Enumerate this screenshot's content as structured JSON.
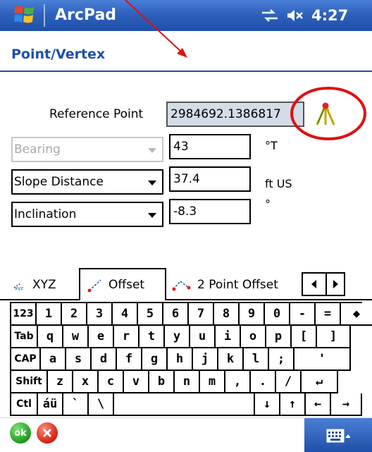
{
  "titlebar": {
    "app_title": "ArcPad",
    "time": "4:27",
    "icons": [
      "windows-start-icon",
      "connectivity-icon",
      "speaker-muted-icon"
    ]
  },
  "page": {
    "title": "Point/Vertex"
  },
  "form": {
    "reference_label": "Reference Point",
    "reference_value": "2984692.1386817",
    "rows": [
      {
        "field": "Bearing",
        "value": "43",
        "unit": "°T",
        "disabled": true
      },
      {
        "field": "Slope Distance",
        "value": "37.4",
        "unit": "ft US",
        "disabled": false
      },
      {
        "field": "Inclination",
        "value": "-8.3",
        "unit": "°",
        "disabled": false
      }
    ]
  },
  "tabs": [
    {
      "label": "XYZ",
      "icon": "xyz-icon",
      "active": false
    },
    {
      "label": "Offset",
      "icon": "offset-icon",
      "active": true
    },
    {
      "label": "2 Point Offset",
      "icon": "two-point-offset-icon",
      "active": false
    }
  ],
  "keyboard": {
    "row1": [
      "123",
      "1",
      "2",
      "3",
      "4",
      "5",
      "6",
      "7",
      "8",
      "9",
      "0",
      "-",
      "=",
      "◆"
    ],
    "row2": [
      "Tab",
      "q",
      "w",
      "e",
      "r",
      "t",
      "y",
      "u",
      "i",
      "o",
      "p",
      "[",
      "]"
    ],
    "row3": [
      "CAP",
      "a",
      "s",
      "d",
      "f",
      "g",
      "h",
      "j",
      "k",
      "l",
      ";",
      "'"
    ],
    "row4": [
      "Shift",
      "z",
      "x",
      "c",
      "v",
      "b",
      "n",
      "m",
      ",",
      ".",
      "/",
      "↵"
    ],
    "row5": [
      "Ctl",
      "áü",
      "`",
      "\\",
      "",
      "↓",
      "↑",
      "←",
      "→"
    ]
  },
  "bottombar": {
    "ok_label": "ok"
  },
  "colors": {
    "titlebar": "#2f62bd",
    "header_text": "#1f4fa8",
    "annotation": "#e01010"
  }
}
